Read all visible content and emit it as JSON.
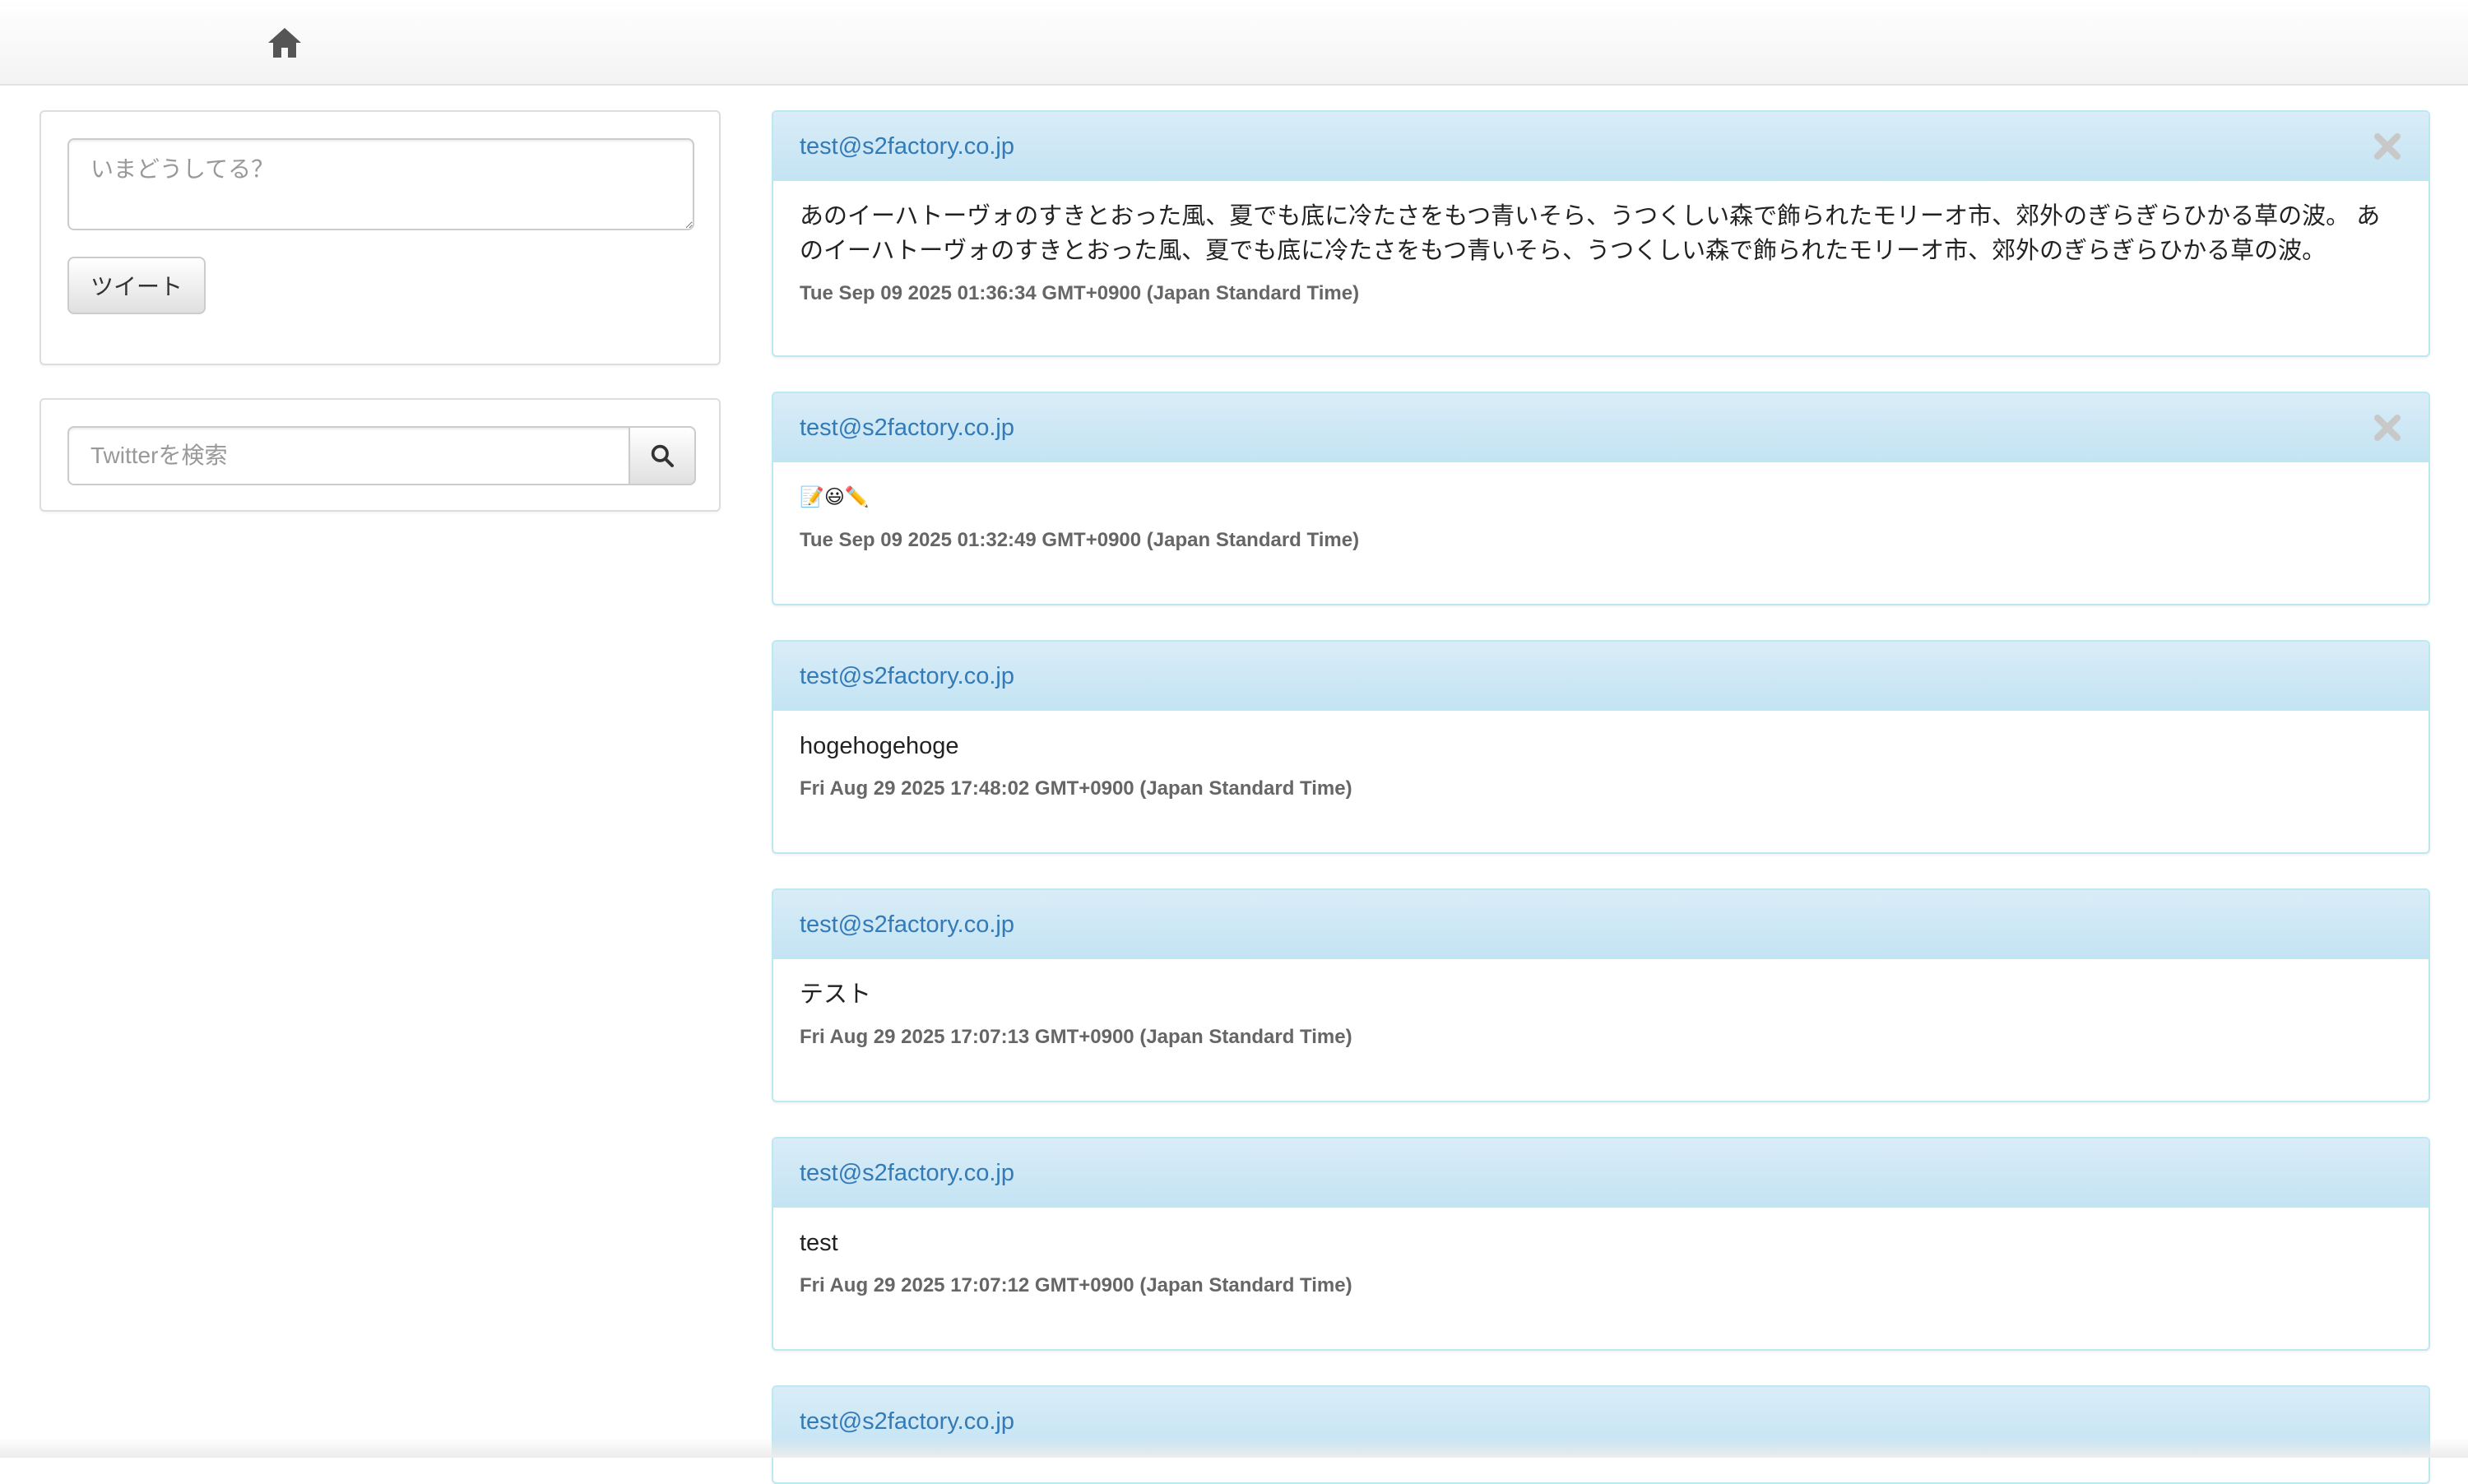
{
  "navbar": {
    "home_icon": "home-icon"
  },
  "tweet_form": {
    "placeholder": "いまどうしてる？",
    "button_label": "ツイート"
  },
  "search": {
    "placeholder": "Twitterを検索",
    "button_icon": "search-icon"
  },
  "tweets": [
    {
      "author": "test@s2factory.co.jp",
      "text": "あのイーハトーヴォのすきとおった風、夏でも底に冷たさをもつ青いそら、うつくしい森で飾られたモリーオ市、郊外のぎらぎらひかる草の波。 あのイーハトーヴォのすきとおった風、夏でも底に冷たさをもつ青いそら、うつくしい森で飾られたモリーオ市、郊外のぎらぎらひかる草の波。",
      "date": "Tue Sep 09 2025 01:36:34 GMT+0900 (Japan Standard Time)",
      "deletable": true
    },
    {
      "author": "test@s2factory.co.jp",
      "text": "📝😃✏️",
      "date": "Tue Sep 09 2025 01:32:49 GMT+0900 (Japan Standard Time)",
      "deletable": true
    },
    {
      "author": "test@s2factory.co.jp",
      "text": "hogehogehoge",
      "date": "Fri Aug 29 2025 17:48:02 GMT+0900 (Japan Standard Time)",
      "deletable": false
    },
    {
      "author": "test@s2factory.co.jp",
      "text": "テスト",
      "date": "Fri Aug 29 2025 17:07:13 GMT+0900 (Japan Standard Time)",
      "deletable": false
    },
    {
      "author": "test@s2factory.co.jp",
      "text": "test",
      "date": "Fri Aug 29 2025 17:07:12 GMT+0900 (Japan Standard Time)",
      "deletable": false
    },
    {
      "author": "test@s2factory.co.jp"
    }
  ],
  "colors": {
    "panel_header": "#d9edf7",
    "panel_border": "#bce8f1",
    "link": "#337ab7",
    "delete_icon": "#c8c8c8"
  }
}
